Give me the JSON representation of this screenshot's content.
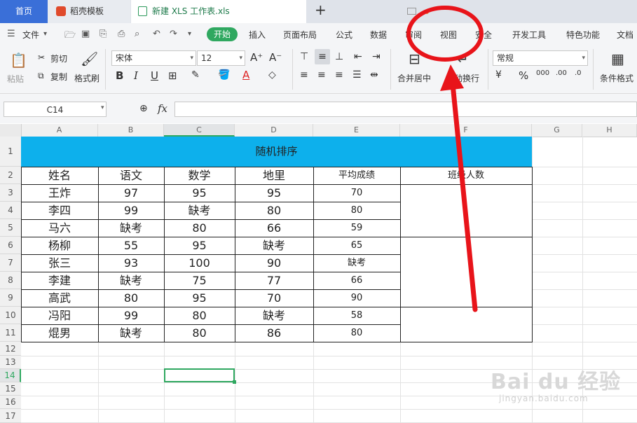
{
  "tabs": {
    "home": "首页",
    "template": "稻壳模板",
    "file": "新建 XLS 工作表.xls",
    "add": "+"
  },
  "menu": {
    "file": "文件",
    "start": "开始",
    "insert": "插入",
    "layout": "页面布局",
    "formula": "公式",
    "data": "数据",
    "review": "审阅",
    "view": "视图",
    "security": "安全",
    "dev": "开发工具",
    "special": "特色功能",
    "doc": "文档"
  },
  "ribbon": {
    "paste": "粘贴",
    "cut": "剪切",
    "copy": "复制",
    "format_painter": "格式刷",
    "font": "宋体",
    "size": "12",
    "bold": "B",
    "italic": "I",
    "underline": "U",
    "merge": "合并居中",
    "wrap": "自动换行",
    "number_format": "常规",
    "percent": "%",
    "cond_format": "条件格式"
  },
  "formula_bar": {
    "name_box": "C14",
    "fx": "fx"
  },
  "columns": [
    "A",
    "B",
    "C",
    "D",
    "E",
    "F",
    "G",
    "H"
  ],
  "rows": [
    "1",
    "2",
    "3",
    "4",
    "5",
    "6",
    "7",
    "8",
    "9",
    "10",
    "11",
    "12",
    "13",
    "14",
    "15",
    "16",
    "17"
  ],
  "sheet": {
    "title": "随机排序",
    "headers": [
      "姓名",
      "语文",
      "数学",
      "地里",
      "平均成绩",
      "班级人数"
    ],
    "data": [
      [
        "王炸",
        "97",
        "95",
        "95",
        "70"
      ],
      [
        "李四",
        "99",
        "缺考",
        "80",
        "80"
      ],
      [
        "马六",
        "缺考",
        "80",
        "66",
        "59"
      ],
      [
        "杨柳",
        "55",
        "95",
        "缺考",
        "65"
      ],
      [
        "张三",
        "93",
        "100",
        "90",
        "缺考"
      ],
      [
        "李建",
        "缺考",
        "75",
        "77",
        "66"
      ],
      [
        "高武",
        "80",
        "95",
        "70",
        "90"
      ],
      [
        "冯阳",
        "99",
        "80",
        "缺考",
        "58"
      ],
      [
        "焜男",
        "缺考",
        "80",
        "86",
        "80"
      ]
    ]
  },
  "watermark": {
    "brand": "Bai du 经验",
    "url": "jingyan.baidu.com"
  },
  "colors": {
    "title_fill": "#0db0ec",
    "accent_green": "#2fa860",
    "annotation_red": "#e8141a"
  }
}
